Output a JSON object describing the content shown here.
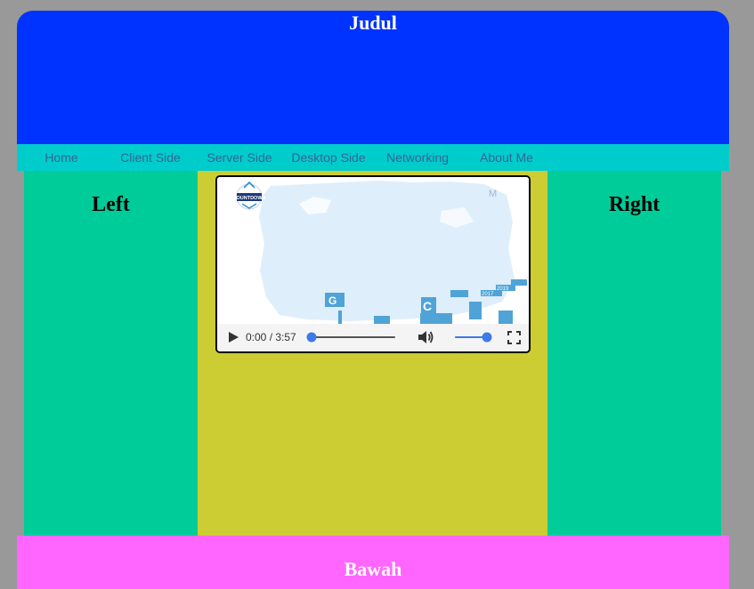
{
  "header": {
    "title": "Judul"
  },
  "nav": {
    "items": [
      {
        "label": "Home"
      },
      {
        "label": "Client Side"
      },
      {
        "label": "Server Side"
      },
      {
        "label": "Desktop Side"
      },
      {
        "label": "Networking"
      },
      {
        "label": "About Me"
      }
    ]
  },
  "left": {
    "title": "Left"
  },
  "right": {
    "title": "Right"
  },
  "video": {
    "time_display": "0:00 / 3:57",
    "progress": 0,
    "volume": 1.0,
    "thumbnail_logo_text": "COUNTDOWN"
  },
  "footer": {
    "title": "Bawah"
  },
  "colors": {
    "background": "#999999",
    "header": "#0033ff",
    "nav": "#00cccc",
    "nav_link": "#336699",
    "side_columns": "#00cc99",
    "center_column": "#cccc33",
    "footer": "#ff66ff",
    "player_accent": "#3b7ae8"
  }
}
